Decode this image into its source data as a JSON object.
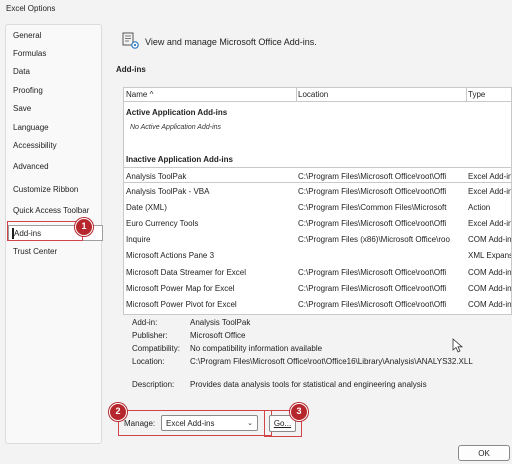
{
  "window": {
    "title": "Excel Options"
  },
  "sidebar": {
    "items": [
      {
        "label": "General"
      },
      {
        "label": "Formulas"
      },
      {
        "label": "Data"
      },
      {
        "label": "Proofing"
      },
      {
        "label": "Save"
      },
      {
        "label": "Language"
      },
      {
        "label": "Accessibility"
      },
      {
        "label": "Advanced"
      },
      {
        "label": "Customize Ribbon"
      },
      {
        "label": "Quick Access Toolbar"
      },
      {
        "label": "Add-ins"
      },
      {
        "label": "Trust Center"
      }
    ],
    "selected": "Add-ins"
  },
  "annotations": {
    "badge1": "1",
    "badge2": "2",
    "badge3": "3",
    "color": "#d04347"
  },
  "header": {
    "text": "View and manage Microsoft Office Add-ins.",
    "icon": "add-ins-gear-icon"
  },
  "section_title": "Add-ins",
  "table": {
    "columns": [
      "Name ^",
      "Location",
      "Type"
    ],
    "active_group": {
      "title": "Active Application Add-ins",
      "empty_message": "No Active Application Add-ins"
    },
    "inactive_group": {
      "title": "Inactive Application Add-ins",
      "rows": [
        {
          "name": "Analysis ToolPak",
          "location": "C:\\Program Files\\Microsoft Office\\root\\Offi",
          "type": "Excel Add-in"
        },
        {
          "name": "Analysis ToolPak - VBA",
          "location": "C:\\Program Files\\Microsoft Office\\root\\Offi",
          "type": "Excel Add-in"
        },
        {
          "name": "Date (XML)",
          "location": "C:\\Program Files\\Common Files\\Microsoft",
          "type": "Action"
        },
        {
          "name": "Euro Currency Tools",
          "location": "C:\\Program Files\\Microsoft Office\\root\\Offi",
          "type": "Excel Add-in"
        },
        {
          "name": "Inquire",
          "location": "C:\\Program Files (x86)\\Microsoft Office\\roo",
          "type": "COM Add-in"
        },
        {
          "name": "Microsoft Actions Pane 3",
          "location": "",
          "type": "XML Expansion"
        },
        {
          "name": "Microsoft Data Streamer for Excel",
          "location": "C:\\Program Files\\Microsoft Office\\root\\Offi",
          "type": "COM Add-in"
        },
        {
          "name": "Microsoft Power Map for Excel",
          "location": "C:\\Program Files\\Microsoft Office\\root\\Offi",
          "type": "COM Add-in"
        },
        {
          "name": "Microsoft Power Pivot for Excel",
          "location": "C:\\Program Files\\Microsoft Office\\root\\Offi",
          "type": "COM Add-in"
        }
      ],
      "selected_index": 0
    }
  },
  "details": {
    "addin_label": "Add-in:",
    "addin_value": "Analysis ToolPak",
    "publisher_label": "Publisher:",
    "publisher_value": "Microsoft Office",
    "compat_label": "Compatibility:",
    "compat_value": "No compatibility information available",
    "location_label": "Location:",
    "location_value": "C:\\Program Files\\Microsoft Office\\root\\Office16\\Library\\Analysis\\ANALYS32.XLL",
    "desc_label": "Description:",
    "desc_value": "Provides data analysis tools for statistical and engineering analysis"
  },
  "manage": {
    "label": "Manage:",
    "selected": "Excel Add-ins",
    "chevron_icon": "chevron-down-icon"
  },
  "buttons": {
    "go": "Go...",
    "ok": "OK"
  }
}
